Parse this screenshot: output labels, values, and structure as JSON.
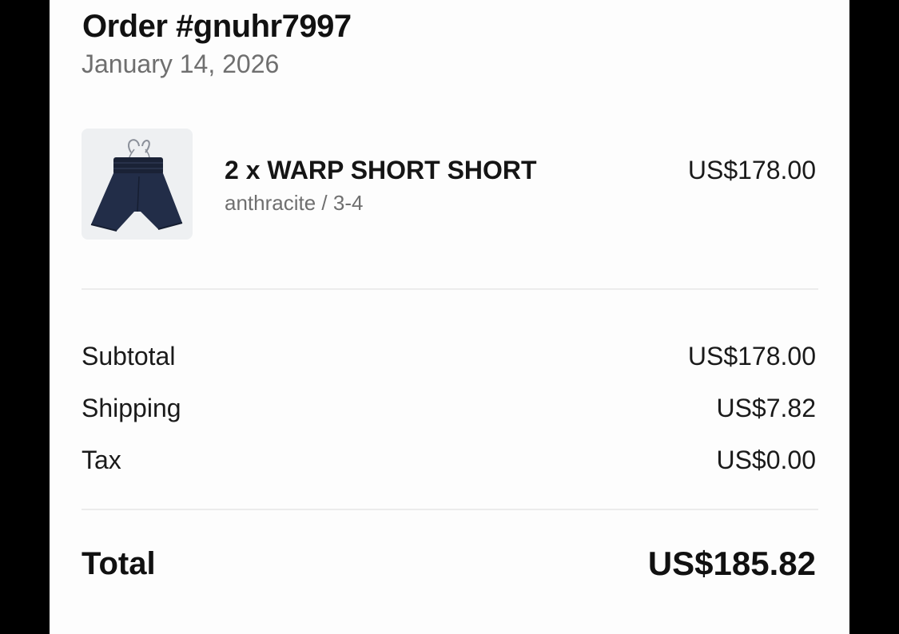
{
  "order": {
    "title": "Order #gnuhr7997",
    "date": "January 14, 2026"
  },
  "line_item": {
    "name": "2 x WARP SHORT SHORT",
    "variant": "anthracite / 3-4",
    "price": "US$178.00",
    "image_icon": "shorts-product-image",
    "image_color": "#1f2a44"
  },
  "summary": {
    "subtotal_label": "Subtotal",
    "subtotal_value": "US$178.00",
    "shipping_label": "Shipping",
    "shipping_value": "US$7.82",
    "tax_label": "Tax",
    "tax_value": "US$0.00",
    "total_label": "Total",
    "total_value": "US$185.82"
  }
}
